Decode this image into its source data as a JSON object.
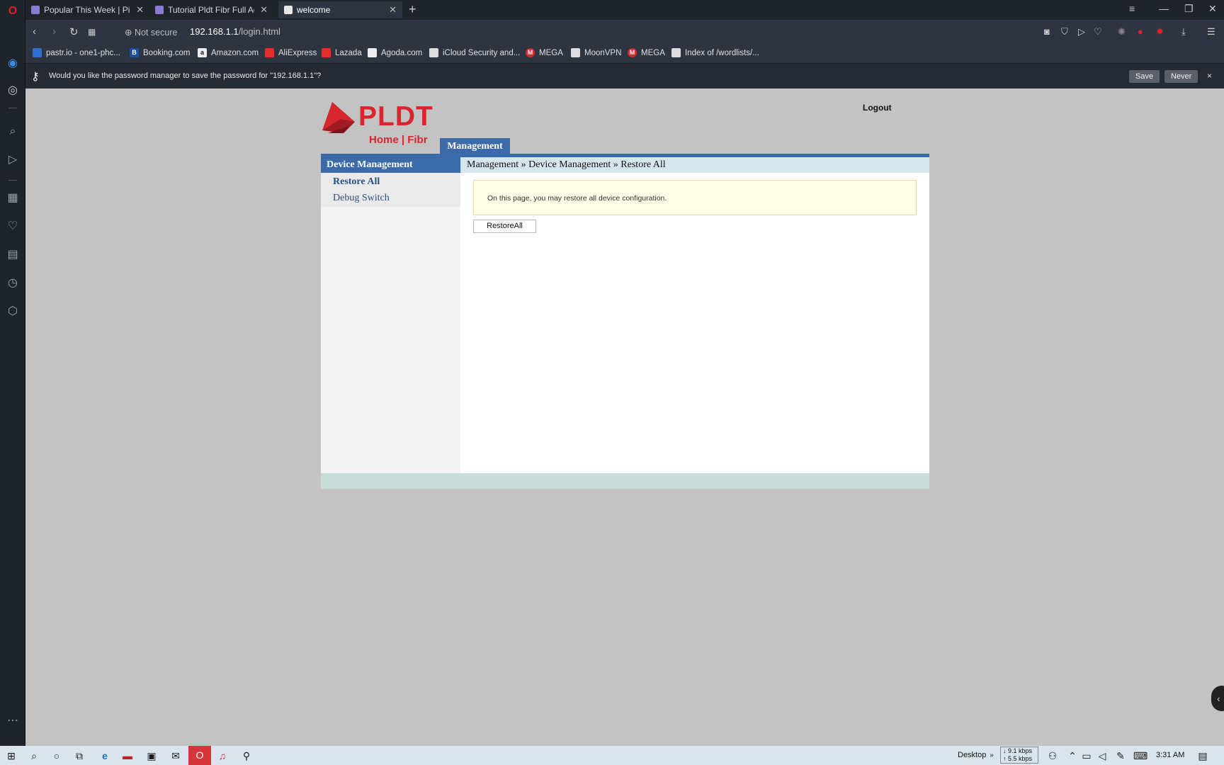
{
  "tabs": [
    {
      "title": "Popular This Week | Pinoy I",
      "active": false
    },
    {
      "title": "Tutorial Pldt Fibr Full Admi",
      "active": false
    },
    {
      "title": "welcome",
      "active": true
    }
  ],
  "address": {
    "security_label": "Not secure",
    "host": "192.168.1.1",
    "path": "/login.html"
  },
  "bookmarks": [
    {
      "label": "pastr.io - one1-phc..."
    },
    {
      "label": "Booking.com"
    },
    {
      "label": "Amazon.com"
    },
    {
      "label": "AliExpress"
    },
    {
      "label": "Lazada"
    },
    {
      "label": "Agoda.com"
    },
    {
      "label": "iCloud Security and..."
    },
    {
      "label": "MEGA"
    },
    {
      "label": "MoonVPN"
    },
    {
      "label": "MEGA"
    },
    {
      "label": "Index of /wordlists/..."
    }
  ],
  "password_prompt": {
    "message": "Would you like the password manager to save the password for \"192.168.1.1\"?",
    "save_label": "Save",
    "never_label": "Never",
    "close_label": "×"
  },
  "router": {
    "logo_text": "PLDT",
    "logo_sub": "Home | Fibr",
    "logout_label": "Logout",
    "top_tab": "Management",
    "menu_header": "Device Management",
    "menu_items": [
      {
        "label": "Restore All",
        "active": true
      },
      {
        "label": "Debug Switch",
        "active": false
      }
    ],
    "breadcrumb": "Management » Device Management » Restore All",
    "info_text": "On this page, you may restore all device configuration.",
    "restore_button": "RestoreAll"
  },
  "taskbar": {
    "desktop_label": "Desktop",
    "download_speed": "9.1 kbps",
    "upload_speed": "5.5 kbps",
    "time": "3:31 AM"
  },
  "colors": {
    "brand_red": "#d8262f",
    "menu_blue": "#3a6aa8",
    "page_bg": "#c3c3c3"
  }
}
